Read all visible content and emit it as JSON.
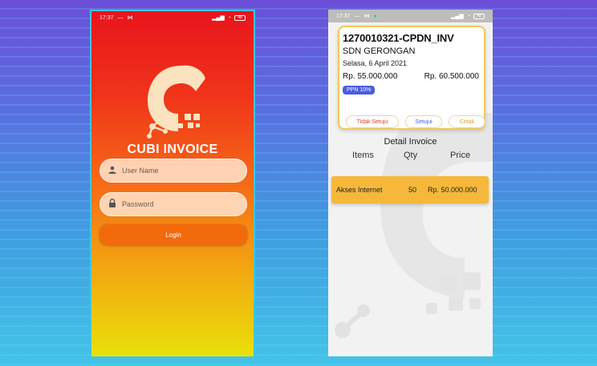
{
  "left_screen": {
    "status": {
      "time": "17:37",
      "battery": "48"
    },
    "app_name": "CUBI INVOICE",
    "username": {
      "placeholder": "User Name",
      "value": ""
    },
    "password": {
      "placeholder": "Password",
      "value": ""
    },
    "login_label": "Login"
  },
  "right_screen": {
    "status": {
      "time": "17:37",
      "battery": "48"
    },
    "invoice": {
      "number": "1270010321-CPDN_INV",
      "school": "SDN GERONGAN",
      "date": "Selasa, 6 April 2021",
      "amount_left": "Rp. 55.000.000",
      "amount_right": "Rp. 60.500.000",
      "ppn_badge": "PPN 10%",
      "actions": {
        "reject": "Tidak Setuju",
        "approve": "Setujui",
        "print": "Cetak"
      }
    },
    "detail_title": "Detail Invoice",
    "columns": {
      "items": "Items",
      "qty": "Qty",
      "price": "Price"
    },
    "rows": [
      {
        "name": "Akses Internet",
        "qty": "50",
        "price": "Rp. 50.000.000"
      }
    ]
  },
  "colors": {
    "gradient_top": "#e8141c",
    "gradient_bottom": "#e9e10a",
    "login_button": "#f26a0c",
    "card_border": "#f3c85a",
    "ppn_badge": "#4a5ce0",
    "row_highlight": "#f6b83a",
    "reject": "#e0402a",
    "print": "#e3a21a"
  }
}
